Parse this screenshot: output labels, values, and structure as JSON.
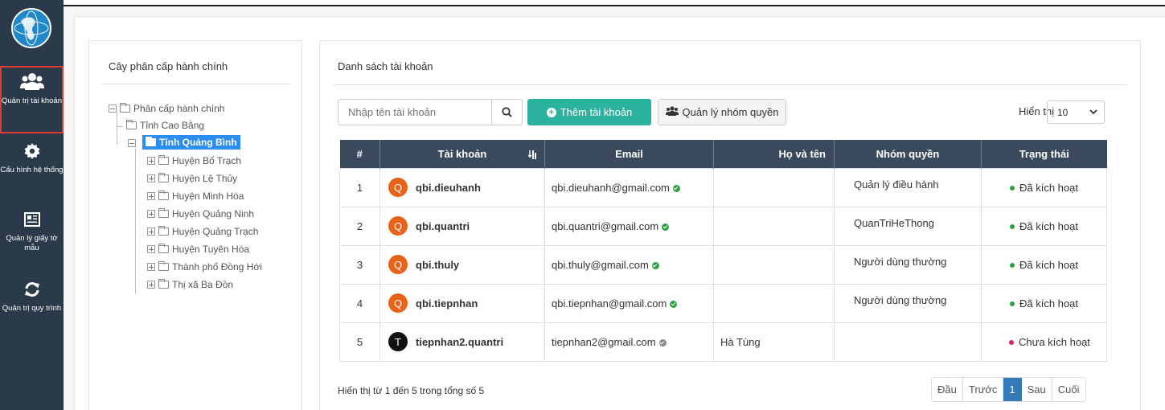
{
  "sidebar": {
    "items": [
      {
        "label": "Quản trị tài khoản",
        "icon": "users-icon",
        "active": true
      },
      {
        "label": "Cấu hình hệ thống",
        "icon": "gear-icon"
      },
      {
        "label": "Quản lý giấy tờ mẫu",
        "icon": "newspaper-icon"
      },
      {
        "label": "Quản trị quy trình",
        "icon": "refresh-icon"
      }
    ]
  },
  "tree": {
    "title": "Cây phân cấp hành chính",
    "root": "Phân cấp hành chính",
    "nodes": [
      "Tỉnh Cao Bằng",
      "Tỉnh Quảng Bình",
      "Huyện Bố Trạch",
      "Huyện Lệ Thủy",
      "Huyện Minh Hóa",
      "Huyện Quảng Ninh",
      "Huyện Quảng Trạch",
      "Huyện Tuyên Hóa",
      "Thành phố Đồng Hới",
      "Thị xã Ba Đồn"
    ]
  },
  "main": {
    "title": "Danh sách tài khoản",
    "search_placeholder": "Nhập tên tài khoản",
    "add_button": "Thêm tài khoản",
    "group_button": "Quản lý nhóm quyền",
    "show_label": "Hiển thị",
    "show_value": "10",
    "columns": [
      "#",
      "Tài khoản",
      "Email",
      "Họ và tên",
      "Nhóm quyền",
      "Trạng thái"
    ],
    "rows": [
      {
        "idx": "1",
        "initial": "Q",
        "account": "qbi.dieuhanh",
        "email": "qbi.dieuhanh@gmail.com",
        "fullname": "",
        "group": "Quản lý điều hành",
        "status": "Đã kích hoạt"
      },
      {
        "idx": "2",
        "initial": "Q",
        "account": "qbi.quantri",
        "email": "qbi.quantri@gmail.com",
        "fullname": "",
        "group": "QuanTriHeThong",
        "status": "Đã kích hoạt"
      },
      {
        "idx": "3",
        "initial": "Q",
        "account": "qbi.thuly",
        "email": "qbi.thuly@gmail.com",
        "fullname": "",
        "group": "Người dùng thường",
        "status": "Đã kích hoạt"
      },
      {
        "idx": "4",
        "initial": "Q",
        "account": "qbi.tiepnhan",
        "email": "qbi.tiepnhan@gmail.com",
        "fullname": "",
        "group": "Người dùng thường",
        "status": "Đã kích hoạt"
      },
      {
        "idx": "5",
        "initial": "T",
        "account": "tiepnhan2.quantri",
        "email": "tiepnhan2@gmail.com",
        "fullname": "Hà Tùng",
        "group": "",
        "status": "Chưa kích hoạt"
      }
    ],
    "footer_info": "Hiển thị từ 1 đến 5 trong tổng số 5",
    "pager": [
      "Đầu",
      "Trước",
      "1",
      "Sau",
      "Cuối"
    ]
  },
  "colors": {
    "sidebar": "#2b3a4a",
    "table_header": "#3a4a5c",
    "add_button": "#2bb3a0",
    "avatar_active": "#e8631c",
    "avatar_inactive": "#111111",
    "status_active": "#2ea043",
    "status_inactive": "#e0245e",
    "selected_node": "#2d8cf0",
    "pager_active": "#337ab7"
  }
}
